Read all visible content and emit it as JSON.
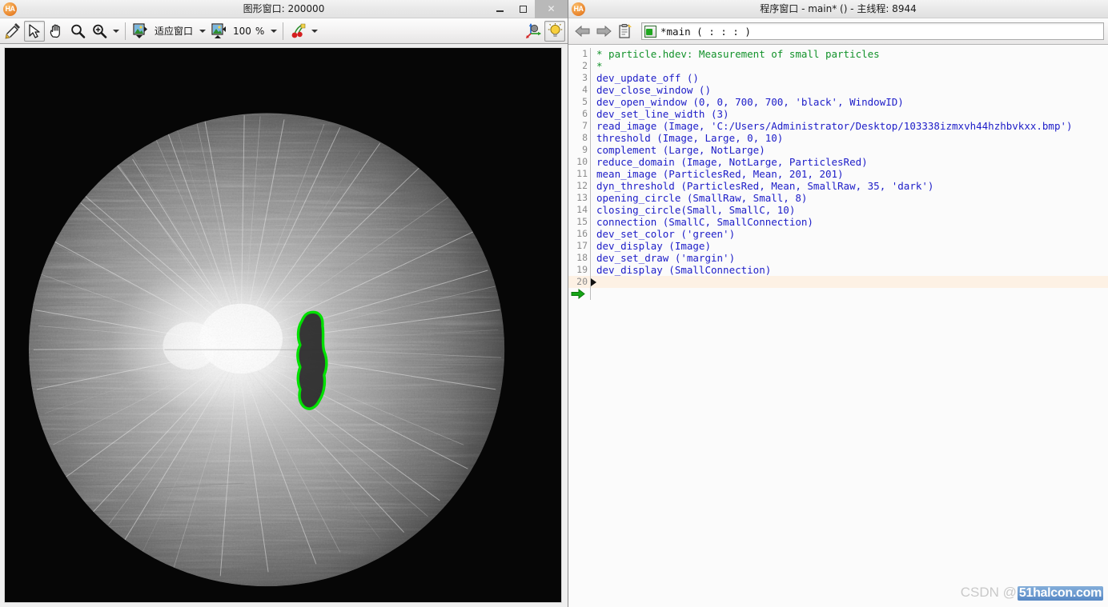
{
  "graphics_window": {
    "app_icon": "halcon-logo-icon",
    "title": "图形窗口: 200000",
    "window_controls": {
      "minimize": "minimize-icon",
      "maximize": "maximize-icon",
      "close": "✕"
    },
    "toolbar": {
      "items": [
        {
          "name": "edit-draw-button",
          "icon": "pencil-palette-icon"
        },
        {
          "name": "select-tool-button",
          "icon": "arrow-cursor-icon",
          "pressed": true
        },
        {
          "name": "pan-tool-button",
          "icon": "hand-icon"
        },
        {
          "name": "zoom-tool-button",
          "icon": "magnifier-icon"
        },
        {
          "name": "zoom-in-tool-button",
          "icon": "magnifier-plus-icon"
        }
      ],
      "fit_window_label": "适应窗口",
      "zoom_value": "100",
      "zoom_unit": "%",
      "fit_icon": "image-fit-icon",
      "zoom_icon": "image-zoom-icon",
      "color_icon": "color-cherries-icon",
      "axes_icon": "3d-axes-icon",
      "lamp_icon": "lightbulb-icon"
    },
    "canvas": {
      "name": "microscope-particle-image",
      "description": "Grayscale microscope image of small fiber particles on black background with a green contour region"
    }
  },
  "program_window": {
    "app_icon": "halcon-logo-icon",
    "title": "程序窗口 - main* () - 主线程: 8944",
    "toolbar": {
      "back_icon": "arrow-left-icon",
      "forward_icon": "arrow-right-icon",
      "clipboard_icon": "clipboard-new-icon",
      "procedure_icon": "procedure-icon",
      "procedure_name": "*main ( : : : )"
    },
    "code": {
      "lines": [
        {
          "num": "1",
          "text": "* particle.hdev: Measurement of small particles",
          "comment": true
        },
        {
          "num": "2",
          "text": "*",
          "comment": true
        },
        {
          "num": "3",
          "text": "dev_update_off ()",
          "comment": false
        },
        {
          "num": "4",
          "text": "dev_close_window ()",
          "comment": false
        },
        {
          "num": "5",
          "text": "dev_open_window (0, 0, 700, 700, 'black', WindowID)",
          "comment": false
        },
        {
          "num": "6",
          "text": "dev_set_line_width (3)",
          "comment": false
        },
        {
          "num": "7",
          "text": "read_image (Image, 'C:/Users/Administrator/Desktop/103338izmxvh44hzhbvkxx.bmp')",
          "comment": false
        },
        {
          "num": "8",
          "text": "threshold (Image, Large, 0, 10)",
          "comment": false
        },
        {
          "num": "9",
          "text": "complement (Large, NotLarge)",
          "comment": false
        },
        {
          "num": "10",
          "text": "reduce_domain (Image, NotLarge, ParticlesRed)",
          "comment": false
        },
        {
          "num": "11",
          "text": "mean_image (ParticlesRed, Mean, 201, 201)",
          "comment": false
        },
        {
          "num": "12",
          "text": "dyn_threshold (ParticlesRed, Mean, SmallRaw, 35, 'dark')",
          "comment": false
        },
        {
          "num": "13",
          "text": "opening_circle (SmallRaw, Small, 8)",
          "comment": false
        },
        {
          "num": "14",
          "text": "closing_circle(Small, SmallC, 10)",
          "comment": false
        },
        {
          "num": "15",
          "text": "connection (SmallC, SmallConnection)",
          "comment": false
        },
        {
          "num": "16",
          "text": "dev_set_color ('green')",
          "comment": false
        },
        {
          "num": "17",
          "text": "dev_display (Image)",
          "comment": false
        },
        {
          "num": "18",
          "text": "dev_set_draw ('margin')",
          "comment": false
        },
        {
          "num": "19",
          "text": "dev_display (SmallConnection)",
          "comment": false
        },
        {
          "num": "20",
          "text": "",
          "comment": false,
          "current": true
        }
      ],
      "marker_line": "20",
      "execution_arrow": "green-arrow-icon"
    },
    "watermark": {
      "prefix": "CSDN @",
      "logo": "51halcon.com"
    }
  },
  "colors": {
    "accent_green": "#1fa81f",
    "code_blue": "#1c1cc8",
    "comment_green": "#12922a",
    "current_line": "#fdf1e4",
    "chrome": "#f1f0f0"
  }
}
